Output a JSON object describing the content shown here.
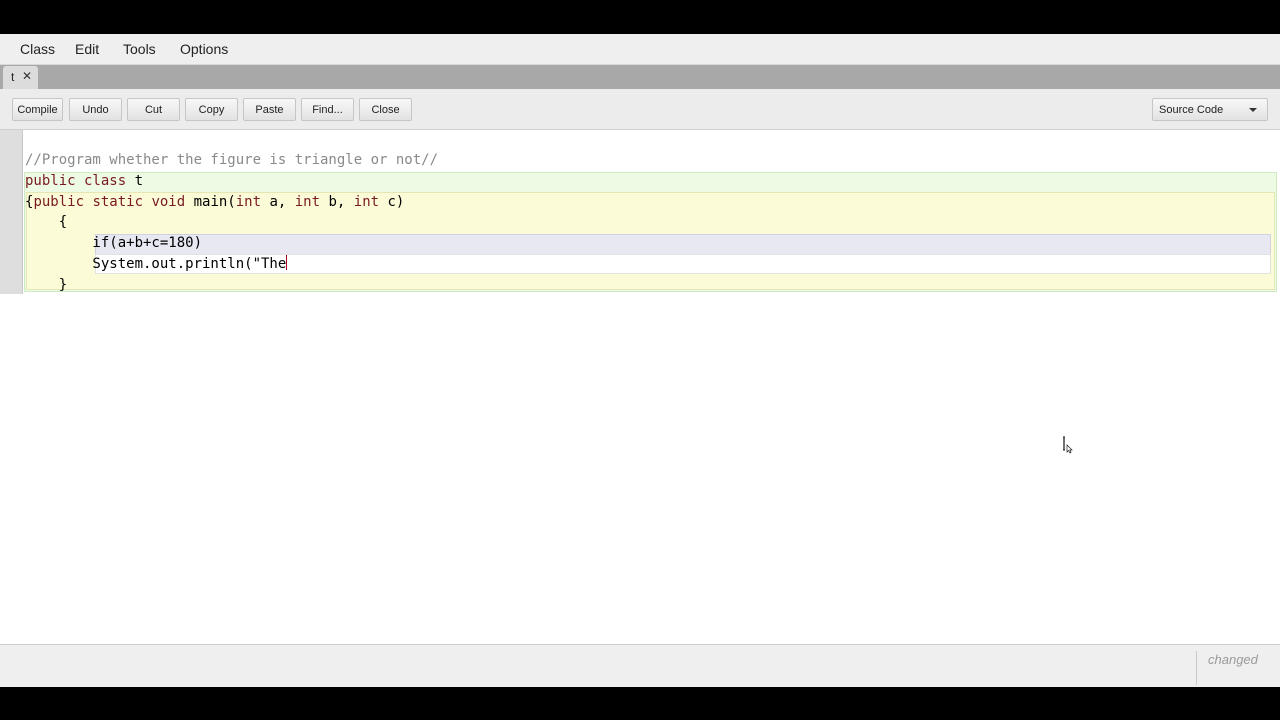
{
  "menu": [
    "Class",
    "Edit",
    "Tools",
    "Options"
  ],
  "tab": {
    "label": "t",
    "close_glyph": "✕"
  },
  "toolbar": {
    "buttons": [
      "Compile",
      "Undo",
      "Cut",
      "Copy",
      "Paste",
      "Find...",
      "Close"
    ],
    "view_select": "Source Code"
  },
  "code": {
    "comment": "//Program whether the figure is triangle or not//",
    "line2_kw": "public class",
    "line2_rest": " t",
    "line3_open": "{",
    "line3_kw": "public static void",
    "line3_mid": " main(",
    "param_type_1": "int",
    "param_rest_1": " a, ",
    "param_type_2": "int",
    "param_rest_2": " b, ",
    "param_type_3": "int",
    "param_rest_3": " c)",
    "line4": "    {",
    "line5": "        if(a+b+c=180)",
    "line6": "        System.out.println(\"The",
    "line7": "    }"
  },
  "status": {
    "text": "changed"
  },
  "icons": {
    "mouse": "text-cursor-icon",
    "dropdown": "chevron-down-icon",
    "close": "close-icon"
  }
}
